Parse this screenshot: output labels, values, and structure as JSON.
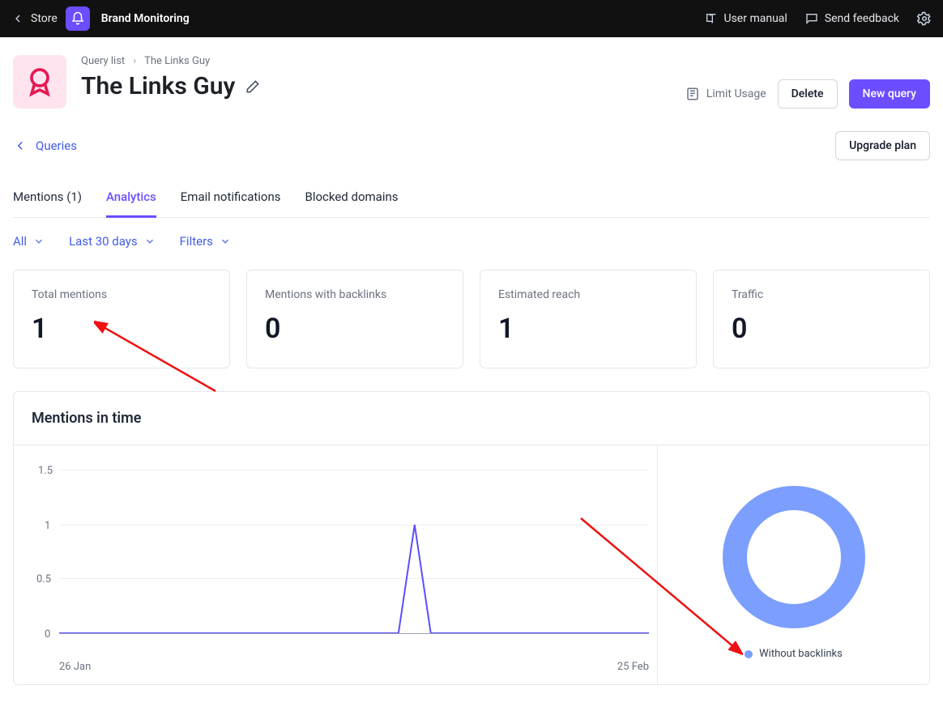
{
  "topbar": {
    "store": "Store",
    "app_title": "Brand Monitoring",
    "user_manual": "User manual",
    "send_feedback": "Send feedback"
  },
  "breadcrumbs": {
    "item1": "Query list",
    "item2": "The Links Guy"
  },
  "page_title": "The Links Guy",
  "header_actions": {
    "limit_usage": "Limit Usage",
    "delete": "Delete",
    "new_query": "New query"
  },
  "back_link": "Queries",
  "upgrade_plan": "Upgrade plan",
  "tabs": {
    "mentions": "Mentions (1)",
    "analytics": "Analytics",
    "email": "Email notifications",
    "blocked": "Blocked domains"
  },
  "filters": {
    "all": "All",
    "range": "Last 30 days",
    "filters": "Filters"
  },
  "stats": {
    "total_mentions": {
      "label": "Total mentions",
      "value": "1"
    },
    "with_backlinks": {
      "label": "Mentions with backlinks",
      "value": "0"
    },
    "reach": {
      "label": "Estimated reach",
      "value": "1"
    },
    "traffic": {
      "label": "Traffic",
      "value": "0"
    }
  },
  "panel_title": "Mentions in time",
  "legend": {
    "without_backlinks": "Without backlinks"
  },
  "chart_data": {
    "type": "line",
    "title": "Mentions in time",
    "xlabel": "",
    "ylabel": "",
    "ylim": [
      0,
      1.5
    ],
    "y_ticks": [
      "1.5",
      "1",
      "0.5",
      "0"
    ],
    "x_range": {
      "start": "26 Jan",
      "end": "25 Feb"
    },
    "series": [
      {
        "name": "Without backlinks",
        "values_note": "Single spike to 1 around mid-range, 0 elsewhere"
      }
    ],
    "donut": {
      "segments": [
        {
          "name": "Without backlinks",
          "value": 1
        }
      ]
    }
  }
}
